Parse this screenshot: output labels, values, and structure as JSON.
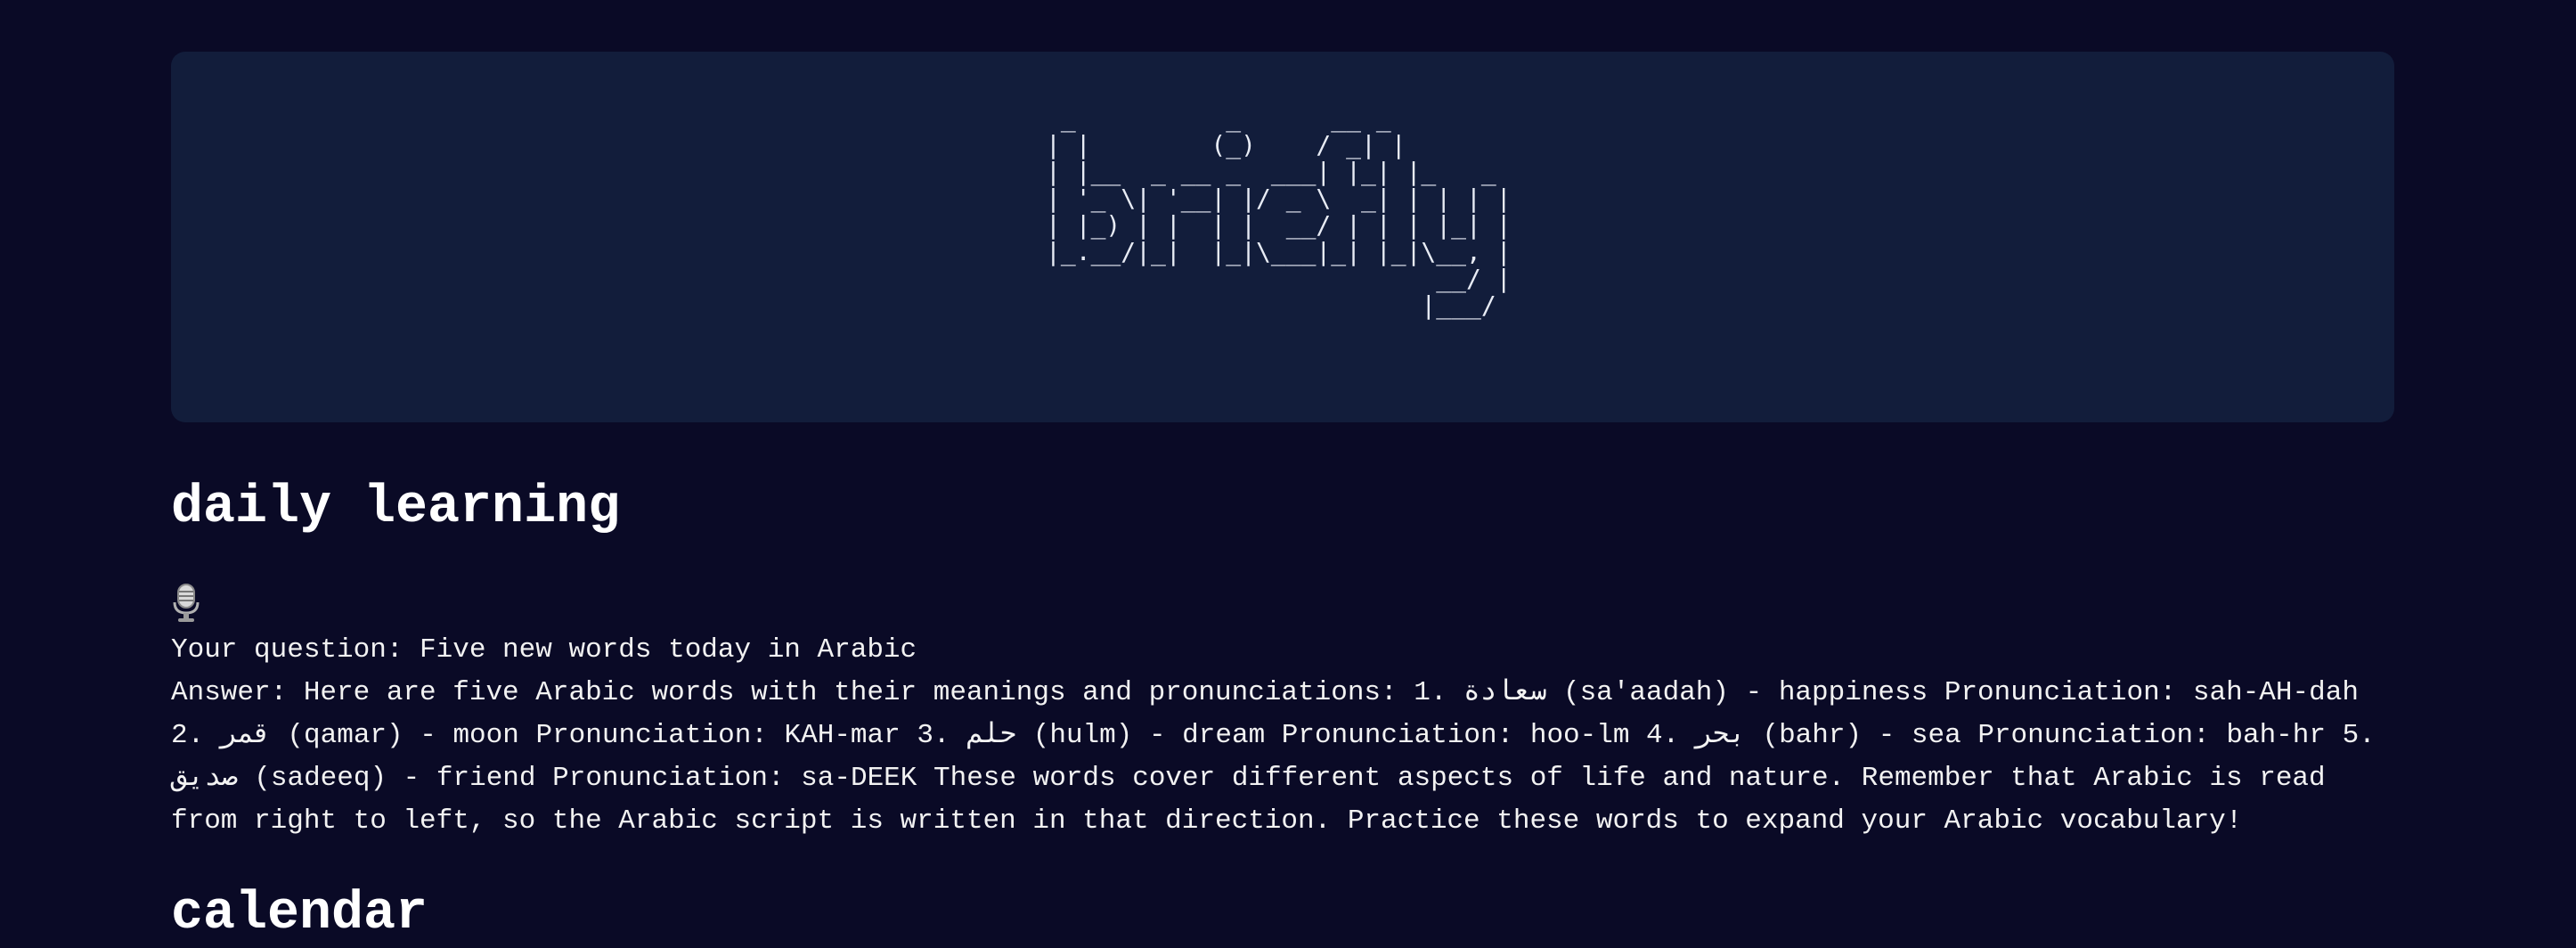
{
  "banner": {
    "ascii_art": " _          _      __ _\n| |        (_)    / _| |\n| |__  _ __ _  ___| |_| |_   _\n| '_ \\| '__| |/ _ \\  _| | | | |\n| |_) | |  | |  __/ | | | |_| |\n|_.__/|_|  |_|\\___|_| |_|\\__, |\n                          __/ |\n                         |___/"
  },
  "daily": {
    "title": "daily learning",
    "question": "Your question: Five new words today in Arabic",
    "answer": "Answer: Here are five Arabic words with their meanings and pronunciations: 1. سعادة (sa'aadah) - happiness Pronunciation: sah-AH-dah 2. قمر (qamar) - moon Pronunciation: KAH-mar 3. حلم (hulm) - dream Pronunciation: hoo-lm 4. بحر (bahr) - sea Pronunciation: bah-hr 5. صديق (sadeeq) - friend Pronunciation: sa-DEEK These words cover different aspects of life and nature. Remember that Arabic is read from right to left, so the Arabic script is written in that direction. Practice these words to expand your Arabic vocabulary!"
  },
  "calendar": {
    "title": "calendar"
  },
  "icons": {
    "mic": "microphone-icon"
  },
  "colors": {
    "background": "#0a0a26",
    "banner": "#121d3b",
    "text": "#ffffff"
  }
}
